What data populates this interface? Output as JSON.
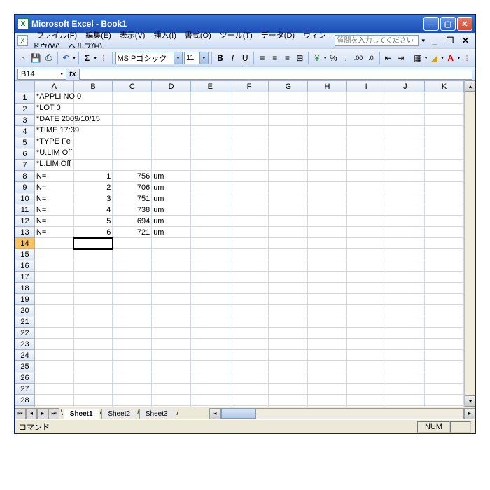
{
  "titlebar": {
    "app": "Microsoft Excel",
    "doc": "Book1",
    "sep": " - "
  },
  "menu": {
    "items": [
      "ファイル(F)",
      "編集(E)",
      "表示(V)",
      "挿入(I)",
      "書式(O)",
      "ツール(T)",
      "データ(D)",
      "ウィンドウ(W)",
      "ヘルプ(H)"
    ],
    "help_placeholder": "質問を入力してください"
  },
  "toolbar": {
    "font_name": "MS Pゴシック",
    "font_size": "11"
  },
  "namebox": "B14",
  "columns": [
    "A",
    "B",
    "C",
    "D",
    "E",
    "F",
    "G",
    "H",
    "I",
    "J",
    "K"
  ],
  "rows": [
    {
      "n": 1,
      "A": "*APPLI NO 0"
    },
    {
      "n": 2,
      "A": "*LOT 0"
    },
    {
      "n": 3,
      "A": "*DATE 2009/10/15"
    },
    {
      "n": 4,
      "A": "*TIME 17:39"
    },
    {
      "n": 5,
      "A": "*TYPE Fe"
    },
    {
      "n": 6,
      "A": "*U.LIM Off"
    },
    {
      "n": 7,
      "A": "*L.LIM Off"
    },
    {
      "n": 8,
      "A": "N=",
      "B": "1",
      "C": "756",
      "D": "um"
    },
    {
      "n": 9,
      "A": "N=",
      "B": "2",
      "C": "706",
      "D": "um"
    },
    {
      "n": 10,
      "A": "N=",
      "B": "3",
      "C": "751",
      "D": "um"
    },
    {
      "n": 11,
      "A": "N=",
      "B": "4",
      "C": "738",
      "D": "um"
    },
    {
      "n": 12,
      "A": "N=",
      "B": "5",
      "C": "694",
      "D": "um"
    },
    {
      "n": 13,
      "A": "N=",
      "B": "6",
      "C": "721",
      "D": "um"
    }
  ],
  "total_rows": 30,
  "active_cell": {
    "row": 14,
    "col": "B"
  },
  "sheets": [
    "Sheet1",
    "Sheet2",
    "Sheet3"
  ],
  "active_sheet": 0,
  "status": {
    "ready": "コマンド",
    "num": "NUM"
  }
}
